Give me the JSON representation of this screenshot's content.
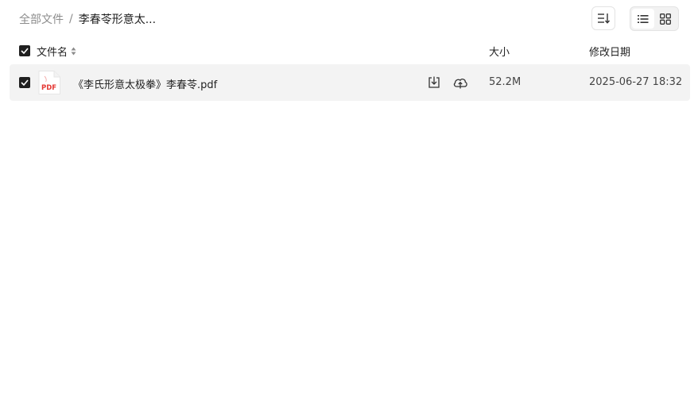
{
  "breadcrumb": {
    "root": "全部文件",
    "separator": "/",
    "current": "李春苓形意太..."
  },
  "toolbar": {
    "sort_icon": "sort-icon",
    "list_view_icon": "list-view-icon",
    "grid_view_icon": "grid-view-icon",
    "active_view": "list"
  },
  "table": {
    "columns": {
      "name": "文件名",
      "size": "大小",
      "date": "修改日期"
    },
    "header_checked": true,
    "rows": [
      {
        "checked": true,
        "icon": "pdf-file-icon",
        "icon_label": "PDF",
        "name": "《李氏形意太极拳》李春苓.pdf",
        "size": "52.2M",
        "date": "2025-06-27 18:32"
      }
    ]
  },
  "colors": {
    "accent_dark": "#1f1f1f",
    "row_highlight": "#f3f3f3",
    "pdf_red": "#e53935",
    "muted_text": "#8c8c8c"
  }
}
